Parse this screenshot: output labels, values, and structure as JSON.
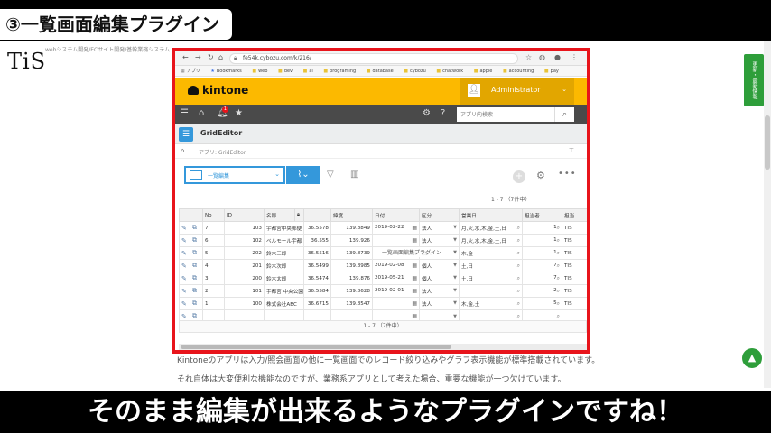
{
  "video": {
    "section_title": "③一覧画面編集プラグイン",
    "caption": "そのまま編集が出来るようなプラグインですね！"
  },
  "site": {
    "logo": "TiS",
    "tagline": "webシステム開発/ECサイト開発/基幹業務システム",
    "side_tab": "更新・最新情報",
    "body_line1": "Kintoneのアプリは入力/照会画面の他に一覧画面でのレコード絞り込みやグラフ表示機能が標準搭載されています。",
    "body_line2": "それ自体は大変便利な機能なのですが、業務系アプリとして考えた場合、重要な機能が一つ欠けています。"
  },
  "browser": {
    "url": "fe54k.cybozu.com/k/216/",
    "bookmarks": [
      "アプリ",
      "Bookmarks",
      "web",
      "dev",
      "ai",
      "programing",
      "database",
      "cybozu",
      "chatwork",
      "apple",
      "accounting",
      "pay"
    ]
  },
  "kintone": {
    "logo": "kintone",
    "user": "Administrator",
    "notification_count": "1",
    "search_placeholder": "アプリ内検索",
    "app_title": "GridEditor",
    "breadcrumb": "アプリ: GridEditor",
    "view_name": "一覧編集",
    "pager": "1 - 7 （7件中）",
    "footer_pager": "1 - 7 （7件中）",
    "drag_tooltip": "一覧画面編集プラグイン"
  },
  "grid": {
    "columns": [
      "",
      "",
      "No",
      "ID",
      "名称",
      "",
      "緯度",
      "日付",
      "区分",
      "営業日",
      "担当者",
      "担当"
    ],
    "rows": [
      {
        "no": "7",
        "id": "103",
        "name": "宇都宮中央郵便",
        "lat": "36.5578",
        "lng": "139.8849",
        "date": "2019-02-22",
        "kind": "法人",
        "days": "月,火,水,木,金,土,日",
        "staff": "1",
        "staff2": "TIS"
      },
      {
        "no": "6",
        "id": "102",
        "name": "ベルモール宇都",
        "lat": "36.555",
        "lng": "139.926",
        "date": "",
        "kind": "法人",
        "days": "月,火,水,木,金,土,日",
        "staff": "1",
        "staff2": "TIS"
      },
      {
        "no": "5",
        "id": "202",
        "name": "鈴木三郎",
        "lat": "36.5516",
        "lng": "139.8739",
        "date": "",
        "kind": "個人",
        "days": "木,金",
        "staff": "1",
        "staff2": "TIS"
      },
      {
        "no": "4",
        "id": "201",
        "name": "鈴木次郎",
        "lat": "36.5499",
        "lng": "139.8985",
        "date": "2019-02-08",
        "kind": "個人",
        "days": "土,日",
        "staff": "7",
        "staff2": "TIS"
      },
      {
        "no": "3",
        "id": "200",
        "name": "鈴木太郎",
        "lat": "36.5474",
        "lng": "139.876",
        "date": "2019-05-21",
        "kind": "個人",
        "days": "土,日",
        "staff": "7",
        "staff2": "TIS"
      },
      {
        "no": "2",
        "id": "101",
        "name": "宇都宮 中央公園",
        "lat": "36.5584",
        "lng": "139.8628",
        "date": "2019-02-01",
        "kind": "法人",
        "days": "",
        "staff": "2",
        "staff2": "TIS"
      },
      {
        "no": "1",
        "id": "100",
        "name": "株式会社ABC",
        "lat": "36.6715",
        "lng": "139.8547",
        "date": "",
        "kind": "法人",
        "days": "木,金,土",
        "staff": "5",
        "staff2": "TIS"
      },
      {
        "no": "",
        "id": "",
        "name": "",
        "lat": "",
        "lng": "",
        "date": "",
        "kind": "",
        "days": "",
        "staff": "",
        "staff2": ""
      }
    ]
  }
}
